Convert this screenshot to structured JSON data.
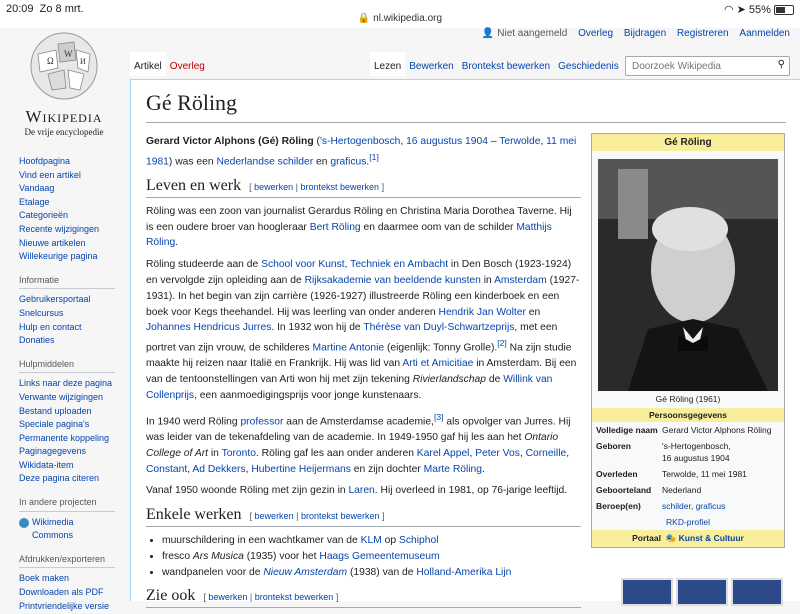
{
  "statusbar": {
    "time": "20:09",
    "date": "Zo 8 mrt.",
    "url": "nl.wikipedia.org",
    "battery": "55%"
  },
  "personal": {
    "not_logged": "Niet aangemeld",
    "links": [
      "Overleg",
      "Bijdragen",
      "Registreren",
      "Aanmelden"
    ]
  },
  "logo": {
    "wordmark": "Wikipedia",
    "tagline": "De vrije encyclopedie"
  },
  "sidebar": {
    "main": [
      "Hoofdpagina",
      "Vind een artikel",
      "Vandaag",
      "Etalage",
      "Categorieën",
      "Recente wijzigingen",
      "Nieuwe artikelen",
      "Willekeurige pagina"
    ],
    "info_heading": "Informatie",
    "info": [
      "Gebruikersportaal",
      "Snelcursus",
      "Hulp en contact",
      "Donaties"
    ],
    "tools_heading": "Hulpmiddelen",
    "tools": [
      "Links naar deze pagina",
      "Verwante wijzigingen",
      "Bestand uploaden",
      "Speciale pagina's",
      "Permanente koppeling",
      "Paginagegevens",
      "Wikidata-item",
      "Deze pagina citeren"
    ],
    "other_heading": "In andere projecten",
    "commons": "Wikimedia Commons",
    "export_heading": "Afdrukken/exporteren",
    "export": [
      "Boek maken",
      "Downloaden als PDF",
      "Printvriendelijke versie"
    ]
  },
  "tabs": {
    "left": [
      "Artikel",
      "Overleg"
    ],
    "right": [
      "Lezen",
      "Bewerken",
      "Brontekst bewerken",
      "Geschiedenis"
    ]
  },
  "search": {
    "placeholder": "Doorzoek Wikipedia"
  },
  "article": {
    "title": "Gé Röling",
    "intro": {
      "bold": "Gerard Victor Alphons (Gé) Röling",
      "a": "(",
      "birthplace": "'s-Hertogenbosch",
      "b": ", ",
      "birthdate": "16 augustus 1904",
      "c": " – ",
      "deathplace": "Terwolde",
      "d": ", ",
      "deathdate": "11 mei 1981",
      "e": ") was een ",
      "nl_painter": "Nederlandse schilder",
      "f": " en ",
      "graphic": "graficus",
      "g": ".",
      "ref": "[1]"
    },
    "h_life": "Leven en werk",
    "edit": {
      "open": "[",
      "bewerken": "bewerken",
      "sep": "|",
      "brontekst": "brontekst bewerken",
      "close": "]"
    },
    "p1": {
      "a": "Röling was een zoon van journalist Gerardus Röling en Christina Maria Dorothea Taverne. Hij is een oudere broer van hoogleraar ",
      "bert": "Bert Röling",
      "b": " en daarmee oom van de schilder ",
      "matthijs": "Matthijs Röling",
      "c": "."
    },
    "p2": {
      "a": "Röling studeerde aan de ",
      "school": "School voor Kunst, Techniek en Ambacht",
      "b": " in Den Bosch (1923-1924) en vervolgde zijn opleiding aan de ",
      "rijks": "Rijksakademie van beeldende kunsten",
      "c": " in ",
      "amsterdam": "Amsterdam",
      "d": " (1927-1931). In het begin van zijn carrière (1926-1927) illustreerde Röling een kinderboek en een boek voor Kegs theehandel. Hij was leerling van onder anderen ",
      "wolter": "Hendrik Jan Wolter",
      "e": " en ",
      "jurres": "Johannes Hendricus Jurres",
      "f": ". In 1932 won hij de ",
      "therese": "Thérèse van Duyl-Schwartzeprijs",
      "g": ", met een portret van zijn vrouw, de schilderes ",
      "martine": "Martine Antonie",
      "h": " (eigenlijk: Tonny Grolle).",
      "ref": "[2]",
      "i": " Na zijn studie maakte hij reizen naar Italië en Frankrijk. Hij was lid van ",
      "arti": "Arti et Amicitiae",
      "j": " in Amsterdam. Bij een van de tentoonstellingen van Arti won hij met zijn tekening ",
      "rivier": "Rivierlandschap",
      "k": " de ",
      "willink": "Willink van Collenprijs",
      "l": ", een aanmoedigingsprijs voor jonge kunstenaars."
    },
    "p3": {
      "a": "In 1940 werd Röling ",
      "professor": "professor",
      "b": " aan de Amsterdamse academie,",
      "ref": "[3]",
      "c": " als opvolger van Jurres. Hij was leider van de tekenafdeling van de academie. In 1949-1950 gaf hij les aan het ",
      "ontario": "Ontario College of Art",
      "d": " in ",
      "toronto": "Toronto",
      "e": ". Röling gaf les aan onder anderen ",
      "appel": "Karel Appel",
      "f": ", ",
      "vos": "Peter Vos",
      "g": ", ",
      "corneille": "Corneille",
      "h": ", ",
      "constant": "Constant",
      "i": ", ",
      "dekkers": "Ad Dekkers",
      "j": ", ",
      "heijermans": "Hubertine Heijermans",
      "k": " en zijn dochter ",
      "marte": "Marte Röling",
      "l": "."
    },
    "p4": {
      "a": "Vanaf 1950 woonde Röling met zijn gezin in ",
      "laren": "Laren",
      "b": ". Hij overleed in 1981, op 76-jarige leeftijd."
    },
    "h_works": "Enkele werken",
    "works": {
      "w1a": "muurschildering in een wachtkamer van de ",
      "klm": "KLM",
      "w1b": " op ",
      "schiphol": "Schiphol",
      "w2a": "fresco ",
      "ars": "Ars Musica",
      "w2b": " (1935) voor het ",
      "haags": "Haags Gemeentemuseum",
      "w3a": "wandpanelen voor de ",
      "nieuw": "Nieuw Amsterdam",
      "w3b": " (1938) van de ",
      "hal": "Holland-Amerika Lijn"
    },
    "h_see": "Zie ook"
  },
  "infobox": {
    "title": "Gé Röling",
    "caption": "Gé Röling (1961)",
    "section": "Persoonsgegevens",
    "rows": {
      "full_k": "Volledige naam",
      "full_v": "Gerard Victor Alphons Röling",
      "born_k": "Geboren",
      "born_v1": "'s-Hertogenbosch,",
      "born_v2": "16 augustus 1904",
      "died_k": "Overleden",
      "died_v": "Terwolde, 11 mei 1981",
      "country_k": "Geboorteland",
      "country_v": "Nederland",
      "job_k": "Beroep(en)",
      "job_v1": "schilder",
      "job_sep": ", ",
      "job_v2": "graficus"
    },
    "rkd": "RKD-profiel",
    "portal_label": "Portaal",
    "portal_link": "Kunst & Cultuur"
  }
}
